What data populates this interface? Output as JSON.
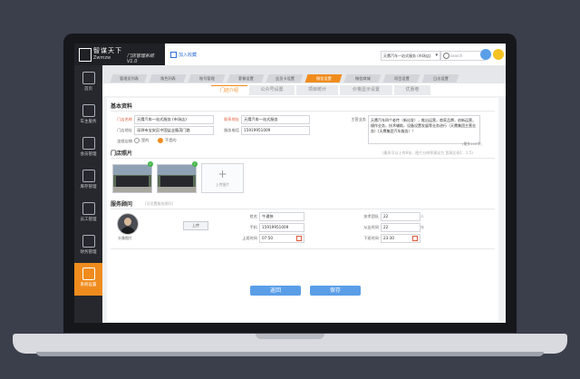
{
  "app": {
    "logo_cn": "智谋天下",
    "logo_en": "Zwmzw",
    "system_name": "门店管理系统",
    "system_version": "V1.0",
    "collect_label": "加入收藏",
    "store_select_value": "天鹰汽车一站式服务 (市场店)",
    "search_placeholder": "search"
  },
  "sidebar": {
    "items": [
      {
        "label": "首页",
        "icon": "home-icon"
      },
      {
        "label": "车主服务",
        "icon": "car-owner-icon"
      },
      {
        "label": "会员管理",
        "icon": "member-icon"
      },
      {
        "label": "库存管理",
        "icon": "inventory-icon"
      },
      {
        "label": "员工管理",
        "icon": "staff-icon"
      },
      {
        "label": "财务管理",
        "icon": "finance-icon"
      },
      {
        "label": "系统设置",
        "icon": "settings-icon"
      }
    ]
  },
  "tabs": [
    {
      "label": "管理员列表"
    },
    {
      "label": "角色列表"
    },
    {
      "label": "账号管理"
    },
    {
      "label": "套餐设置"
    },
    {
      "label": "会员卡设置"
    },
    {
      "label": "微信设置"
    },
    {
      "label": "微信商城"
    },
    {
      "label": "项目设置"
    },
    {
      "label": "日志设置"
    }
  ],
  "subtabs": [
    {
      "label": "门店介绍"
    },
    {
      "label": "公众号设置"
    },
    {
      "label": "项目统计"
    },
    {
      "label": "价格显示设置"
    },
    {
      "label": "优惠卷"
    }
  ],
  "basic": {
    "title": "基本资料",
    "store_name_label": "门店名称",
    "store_name_value": "天鹰汽车一站式服务 (市场店)",
    "contact_label": "联系地址",
    "contact_value": "天鹰汽车一站式服务",
    "address_label": "门店地址",
    "address_value": "深圳市宝安区中国盐业隆茂门路",
    "hotline_label": "服务电话",
    "hotline_value": "15919951009",
    "status_label": "连锁店铺",
    "radio_yes": "是的",
    "radio_no": "不是的",
    "intro_label": "主营业务",
    "intro_text": "天鹰汽车四个老传（新出发），推出运营，商家品牌，创新运营，操作业务，技术辅助，设备设置发展等业务进行（天鹰集团主营业务）(天鹰集团汽车服务）！",
    "intro_counter": "(最多100字)"
  },
  "photos": {
    "title": "门店照片",
    "hint": "(最多可以上传8张，图片分辨率建议为 宽高比例1：1.5)",
    "upload_label": "上传图片"
  },
  "advisor": {
    "title": "服务顾问",
    "sub": "(可设置服务顾问)",
    "avatar_caption": "头像图片",
    "upload_btn": "上传",
    "name_label": "姓名",
    "name_value": "牛通快",
    "phone_label": "手机",
    "phone_value": "15919951009",
    "start_label": "上班时间",
    "start_value": "07:50",
    "tech_label": "技术团队",
    "tech_value": "22",
    "tech_unit": "人",
    "year_label": "从业时间",
    "year_value": "22",
    "year_unit": "年",
    "end_label": "下班时间",
    "end_value": "23:30"
  },
  "actions": {
    "back": "返回",
    "save": "保存"
  },
  "colors": {
    "accent": "#f08c1e",
    "primary_button": "#5a9ee8",
    "sidebar": "#26282d"
  }
}
